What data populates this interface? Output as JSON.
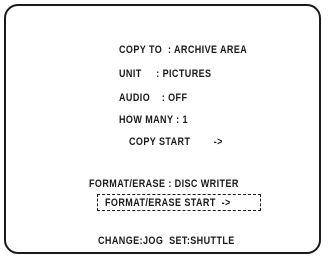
{
  "menu": {
    "copy_to": "COPY TO  : ARCHIVE AREA",
    "unit": "UNIT     : PICTURES",
    "audio": "AUDIO    : OFF",
    "how_many": "HOW MANY : 1",
    "copy_start": "COPY START        ->",
    "format_erase": "FORMAT/ERASE : DISC WRITER",
    "format_erase_start": "FORMAT/ERASE START  ->",
    "footer": "CHANGE:JOG  SET:SHUTTLE"
  }
}
